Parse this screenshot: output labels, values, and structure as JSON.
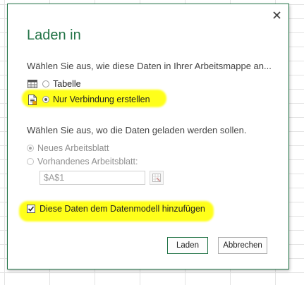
{
  "dialog": {
    "title": "Laden in",
    "close_glyph": "✕",
    "prompt_view": "Wählen Sie aus, wie diese Daten in Ihrer Arbeitsmappe an...",
    "view_options": [
      {
        "label": "Tabelle",
        "icon": "table-icon",
        "selected": false
      },
      {
        "label": "Nur Verbindung erstellen",
        "icon": "connection-icon",
        "selected": true
      }
    ],
    "prompt_location": "Wählen Sie aus, wo die Daten geladen werden sollen.",
    "location_options": [
      {
        "label": "Neues Arbeitsblatt",
        "selected": true,
        "disabled": true
      },
      {
        "label": "Vorhandenes Arbeitsblatt:",
        "selected": false,
        "disabled": true
      }
    ],
    "cell_reference": "$A$1",
    "data_model_checkbox": {
      "label": "Diese Daten dem Datenmodell hinzufügen",
      "checked": true
    },
    "buttons": {
      "load": "Laden",
      "cancel": "Abbrechen"
    }
  },
  "colors": {
    "accent": "#217346",
    "highlight": "#ffff1a"
  }
}
